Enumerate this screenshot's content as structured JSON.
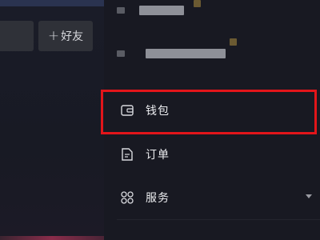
{
  "left": {
    "add_friend": {
      "label": "好友"
    }
  },
  "drawer": {
    "menu": [
      {
        "label": "钱包",
        "icon": "wallet-icon"
      },
      {
        "label": "订单",
        "icon": "order-icon"
      },
      {
        "label": "服务",
        "icon": "services-grid-icon"
      }
    ]
  },
  "colors": {
    "background": "#161720",
    "highlight_box": "#e2151a",
    "button_bg": "#2f3138",
    "text": "#ecedf0"
  }
}
